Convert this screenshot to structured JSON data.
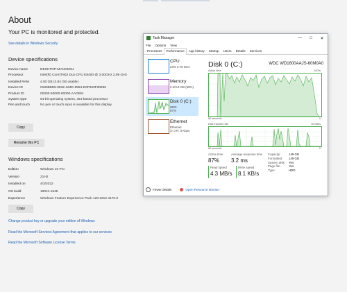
{
  "about": {
    "title": "About",
    "protected": "Your PC is monitored and protected.",
    "security_link": "See details in Windows Security"
  },
  "device_specs": {
    "heading": "Device specifications",
    "rows": [
      {
        "k": "Device name",
        "v": "DESKTOP-MANOMSJ"
      },
      {
        "k": "Processor",
        "v": "Intel(R) Core(TM)2 Duo CPU     E8400  @ 3.00GHz   2.99 GHz"
      },
      {
        "k": "Installed RAM",
        "v": "4.00 GB (3.84 GB usable)"
      },
      {
        "k": "Device ID",
        "v": "01808BD6-0832-464D-8954-E0F693F00836"
      },
      {
        "k": "Product ID",
        "v": "00330-50000-00000-AAOEM"
      },
      {
        "k": "System type",
        "v": "64-bit operating system, x64-based processor"
      },
      {
        "k": "Pen and touch",
        "v": "No pen or touch input is available for this display"
      }
    ],
    "copy_label": "Copy",
    "rename_label": "Rename this PC"
  },
  "windows_specs": {
    "heading": "Windows specifications",
    "rows": [
      {
        "k": "Edition",
        "v": "Windows 10 Pro"
      },
      {
        "k": "Version",
        "v": "21H2"
      },
      {
        "k": "Installed on",
        "v": "4/3/2022"
      },
      {
        "k": "OS build",
        "v": "19044.1645"
      },
      {
        "k": "Experience",
        "v": "Windows Feature Experience Pack 120.2212.4170.0"
      }
    ],
    "copy_label": "Copy"
  },
  "links": [
    "Change product key or upgrade your edition of Windows",
    "Read the Microsoft Services Agreement that applies to our services",
    "Read the Microsoft Software License Terms"
  ],
  "taskmanager": {
    "title": "Task Manager",
    "menu": [
      "File",
      "Options",
      "View"
    ],
    "tabs": [
      "Processes",
      "Performance",
      "App history",
      "Startup",
      "Users",
      "Details",
      "Services"
    ],
    "active_tab": "Performance",
    "sidebar": [
      {
        "name": "CPU",
        "sub1": "23%  2.78 GHz",
        "sub2": "",
        "color": "#1c7fd6"
      },
      {
        "name": "Memory",
        "sub1": "2.2/3.8 GB (58%)",
        "sub2": "",
        "color": "#8e44ad"
      },
      {
        "name": "Disk 0 (C:)",
        "sub1": "HDD",
        "sub2": "87%",
        "color": "#4caf50"
      },
      {
        "name": "Ethernet",
        "sub1": "Ethernet",
        "sub2": "S: 0  R: 0 Kbps",
        "color": "#a0522d"
      }
    ],
    "disk_title": "Disk 0 (C:)",
    "disk_model": "WDC WD1600AAJS-60M0A0",
    "graph1_label": "Active time",
    "graph1_max": "100%",
    "graph2_label": "Disk transfer rate",
    "graph2_max": "10 MB/s",
    "seconds_label": "60 seconds",
    "zero": "0",
    "stats": {
      "active_time_label": "Active time",
      "active_time": "87%",
      "response_label": "Average response time",
      "response": "3.2 ms",
      "read_label": "Read speed",
      "read": "4.3 MB/s",
      "write_label": "Write speed",
      "write": "8.1 KB/s"
    },
    "props": [
      {
        "k": "Capacity:",
        "v": "149 GB"
      },
      {
        "k": "Formatted:",
        "v": "149 GB"
      },
      {
        "k": "System disk:",
        "v": "Yes"
      },
      {
        "k": "Page file:",
        "v": "Yes"
      },
      {
        "k": "Type:",
        "v": "HDD"
      }
    ],
    "fewer_details": "Fewer details",
    "open_monitor": "Open Resource Monitor",
    "accent": "#4caf50"
  }
}
